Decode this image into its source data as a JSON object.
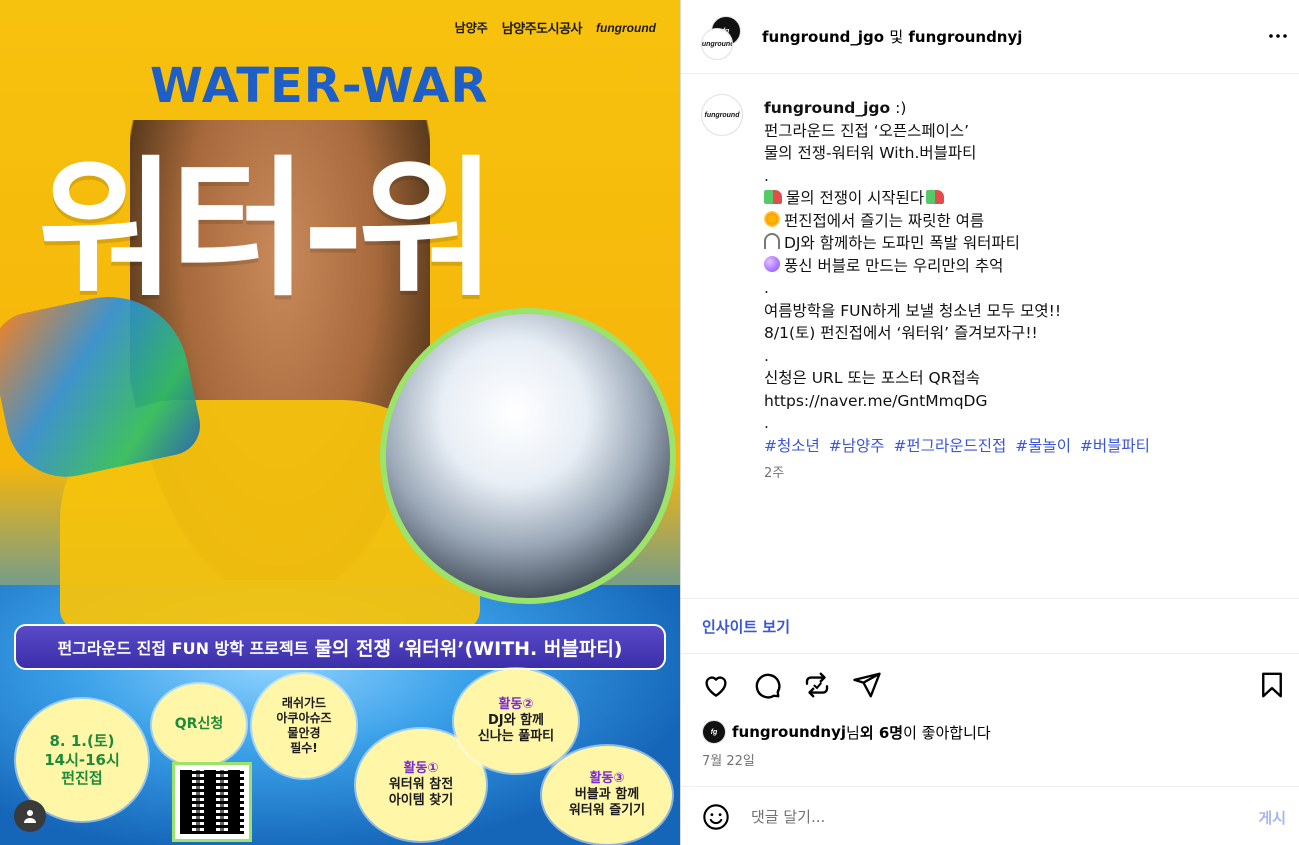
{
  "poster": {
    "logos": [
      "남양주",
      "남양주도시공사",
      "funground"
    ],
    "title_en": "WATER-WAR",
    "title_ko": "워터-워",
    "banner_small": "펀그라운드 진접 FUN 방학 프로젝트",
    "banner_big": "물의 전쟁 ‘워터워’(WITH. 버블파티)",
    "burst_date": [
      "8. 1.(토)",
      "14시-16시",
      "펀진접"
    ],
    "burst_qr": "QR신청",
    "burst_gear": [
      "래쉬가드",
      "아쿠아슈즈",
      "물안경",
      "필수!"
    ],
    "burst_act1": [
      "활동①",
      "워터워 참전",
      "아이템 찾기"
    ],
    "burst_act2": [
      "활동②",
      "DJ와 함께",
      "신나는 풀파티"
    ],
    "burst_act3": [
      "활동③",
      "버블과 함께",
      "워터워 즐기기"
    ]
  },
  "header": {
    "user1": "funground_jgo",
    "joiner": "및",
    "user2": "fungroundnyj",
    "more_icon": "more-horizontal-icon"
  },
  "caption": {
    "user": "funground_jgo",
    "first": ":)",
    "lines": [
      "펀그라운드 진접 ‘오픈스페이스’",
      "물의 전쟁-워터워 With.버블파티",
      "."
    ],
    "emoji_lines": [
      {
        "icon": "water-gun-icon",
        "text": "물의 전쟁이 시작된다",
        "trail": "water-gun-icon"
      },
      {
        "icon": "sun-icon",
        "text": "펀진접에서 즐기는 짜릿한 여름"
      },
      {
        "icon": "headphone-icon",
        "text": "DJ와 함께하는 도파민 폭발 워터파티"
      },
      {
        "icon": "bubbles-icon",
        "text": "풍신 버블로 만드는 우리만의 추억"
      }
    ],
    "lines2": [
      ".",
      "여름방학을 FUN하게 보낼 청소년 모두 모엿!!",
      "8/1(토) 펀진접에서 ‘워터워’ 즐겨보자구!!",
      ".",
      "신청은 URL 또는 포스터 QR접속",
      "https://naver.me/GntMmqDG",
      "."
    ],
    "hashtags": [
      "#청소년",
      "#남양주",
      "#펀그라운드진접",
      "#물놀이",
      "#버블파티"
    ],
    "time": "2주"
  },
  "insights": "인사이트 보기",
  "likes": {
    "user": "fungroundnyj",
    "suffix1": "님 ",
    "others": "외 6명",
    "suffix2": "이 좋아합니다"
  },
  "post_date": "7월 22일",
  "comment": {
    "placeholder": "댓글 달기...",
    "post_label": "게시"
  },
  "colors": {
    "link": "#3b55d9",
    "muted": "#737373",
    "post_disabled": "#a8b6f0"
  }
}
